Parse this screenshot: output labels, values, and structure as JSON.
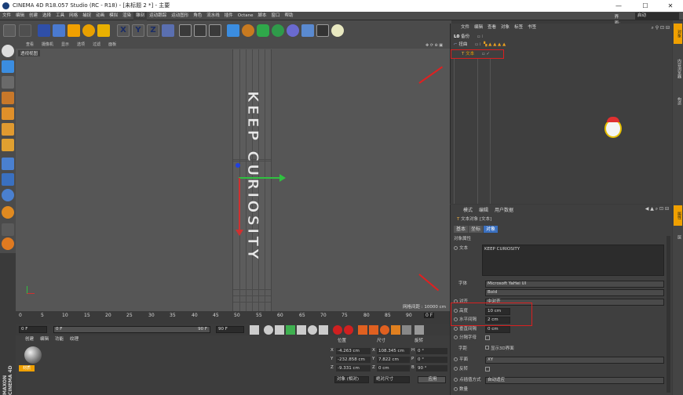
{
  "app": {
    "title": "CINEMA 4D R18.057 Studio (RC - R18) - [未标题 2 *] - 主要"
  },
  "window_controls": {
    "minimize": "—",
    "maximize": "☐",
    "close": "✕"
  },
  "menubar": {
    "items": [
      "文件",
      "编辑",
      "创建",
      "选择",
      "工具",
      "网格",
      "捕捉",
      "动画",
      "模拟",
      "渲染",
      "雕刻",
      "运动跟踪",
      "运动图形",
      "角色",
      "流水线",
      "插件",
      "Octane",
      "脚本",
      "窗口",
      "帮助"
    ],
    "layout_label": "界面:",
    "layout_value": "启动"
  },
  "viewport": {
    "menu": [
      "查看",
      "摄像机",
      "显示",
      "选项",
      "过滤",
      "面板"
    ],
    "label": "透视视图",
    "object_text": "KEEP CURIOSITY",
    "grid_info": "网格间距 : 10000 cm"
  },
  "timeline": {
    "ticks": [
      "0",
      "5",
      "10",
      "15",
      "20",
      "25",
      "30",
      "35",
      "40",
      "45",
      "50",
      "55",
      "60",
      "65",
      "70",
      "75",
      "80",
      "85",
      "90"
    ],
    "frame_end_label": "0 F",
    "start_field": "0 F",
    "start_field2": "0 F",
    "end_field": "90 F",
    "end_field2": "90 F",
    "track_end": "90 F"
  },
  "materials": {
    "tabs": [
      "创建",
      "编辑",
      "功能",
      "纹理"
    ],
    "material_name": "材质"
  },
  "coordinates": {
    "headers": {
      "pos": "位置",
      "size": "尺寸",
      "rot": "旋转"
    },
    "rows": [
      {
        "axis": "X",
        "pos": "-4.263 cm",
        "size": "108.345 cm",
        "rlabel": "H",
        "rot": "0 °"
      },
      {
        "axis": "Y",
        "pos": "-232.858 cm",
        "size": "7.822 cm",
        "rlabel": "P",
        "rot": "0 °"
      },
      {
        "axis": "Z",
        "pos": "-9.331 cm",
        "size": "0 cm",
        "rlabel": "B",
        "rot": "90 °"
      }
    ],
    "mode1": "对象 (相对)",
    "mode2": "绝对尺寸",
    "apply": "应用"
  },
  "object_manager": {
    "menu": [
      "文件",
      "编辑",
      "查看",
      "对象",
      "标签",
      "书签"
    ],
    "objects": [
      {
        "name": "备份"
      },
      {
        "name": "扭曲"
      },
      {
        "name": "文本"
      }
    ]
  },
  "attributes": {
    "menu": [
      "模式",
      "编辑",
      "用户数据"
    ],
    "object_label": "文本对象 [文本]",
    "tabs": [
      "基本",
      "坐标",
      "对象"
    ],
    "section": "对象属性",
    "text_label": "文本",
    "text_value": "KEEP CURIOSITY",
    "font_label": "字体",
    "font_value": "Microsoft YaHei UI",
    "style_value": "Bold",
    "align_label": "对齐",
    "align_value": "中对齐",
    "height_label": "高度",
    "height_value": "10 cm",
    "hspacing_label": "水平间隔",
    "hspacing_value": "2 cm",
    "vspacing_label": "垂直间隔",
    "vspacing_value": "0 cm",
    "kerning_label": "分隔字母",
    "kerning_label2": "字距",
    "show3d_label": "显示3D界面",
    "plane_label": "平面",
    "plane_value": "XY",
    "reverse_label": "反转",
    "interp_label": "点插值方式",
    "interp_value": "自动适应",
    "count_label": "数量"
  },
  "right_tabs": [
    "对象",
    "内容浏览器",
    "构造",
    "属性",
    "层"
  ],
  "logo": {
    "line1": "MAXON",
    "line2": "CINEMA 4D"
  },
  "accent": {
    "red": "#d92020",
    "orange": "#f0a000",
    "blue": "#3b6ee0"
  }
}
